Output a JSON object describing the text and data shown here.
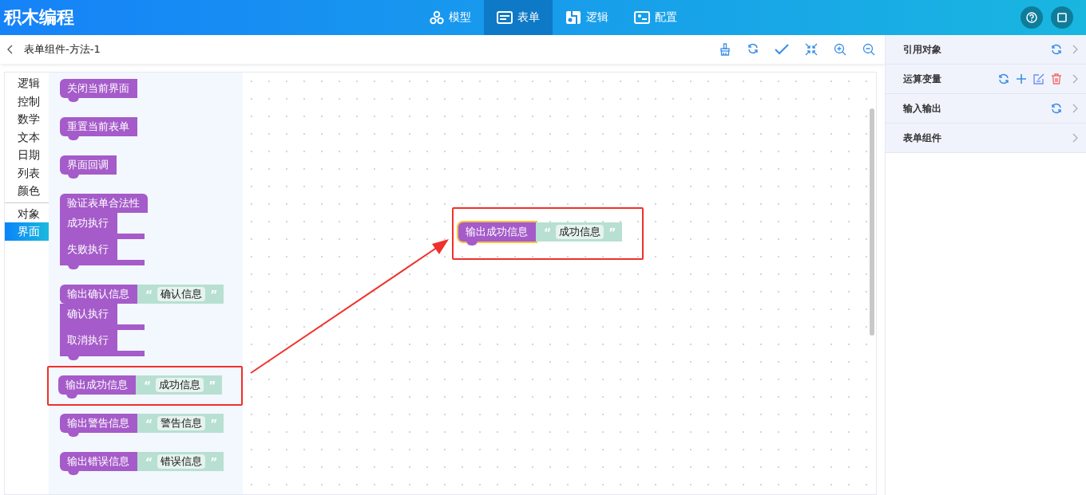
{
  "app": {
    "title": "积木编程"
  },
  "nav_tabs": [
    {
      "label": "模型",
      "kind": "model",
      "selected": false
    },
    {
      "label": "表单",
      "kind": "form",
      "selected": true
    },
    {
      "label": "逻辑",
      "kind": "logic",
      "selected": false
    },
    {
      "label": "配置",
      "kind": "config",
      "selected": false
    }
  ],
  "editor": {
    "title": "表单组件-方法-1"
  },
  "category_groups": [
    {
      "items": [
        {
          "label": "逻辑",
          "selected": false
        },
        {
          "label": "控制",
          "selected": false
        },
        {
          "label": "数学",
          "selected": false
        },
        {
          "label": "文本",
          "selected": false
        },
        {
          "label": "日期",
          "selected": false
        },
        {
          "label": "列表",
          "selected": false
        },
        {
          "label": "颜色",
          "selected": false
        }
      ]
    },
    {
      "items": [
        {
          "label": "对象",
          "selected": false
        },
        {
          "label": "界面",
          "selected": true
        }
      ]
    }
  ],
  "flyout_blocks": [
    {
      "kind": "simple",
      "label": "关闭当前界面"
    },
    {
      "kind": "simple",
      "label": "重置当前表单"
    },
    {
      "kind": "simple",
      "label": "界面回调"
    },
    {
      "kind": "branches",
      "label": "验证表单合法性",
      "branches": [
        "成功执行",
        "失败执行"
      ]
    },
    {
      "kind": "message",
      "label": "输出确认信息",
      "open_quote": "“",
      "value": "确认信息",
      "close_quote": "”",
      "branches": [
        "确认执行",
        "取消执行"
      ]
    },
    {
      "kind": "message",
      "label": "输出成功信息",
      "open_quote": "“",
      "value": "成功信息",
      "close_quote": "”",
      "highlighted": true
    },
    {
      "kind": "message",
      "label": "输出警告信息",
      "open_quote": "“",
      "value": "警告信息",
      "close_quote": "”"
    },
    {
      "kind": "message",
      "label": "输出错误信息",
      "open_quote": "“",
      "value": "错误信息",
      "close_quote": "”"
    }
  ],
  "canvas_block": {
    "label": "输出成功信息",
    "open_quote": "“",
    "value": "成功信息",
    "close_quote": "”",
    "selected": true
  },
  "side_panel": [
    {
      "label": "引用对象",
      "tools": [
        {
          "kind": "refresh"
        }
      ]
    },
    {
      "label": "运算变量",
      "tools": [
        {
          "kind": "refresh"
        },
        {
          "kind": "add"
        },
        {
          "kind": "edit"
        },
        {
          "kind": "delete"
        }
      ]
    },
    {
      "label": "输入输出",
      "tools": [
        {
          "kind": "refresh"
        }
      ]
    },
    {
      "label": "表单组件"
    }
  ]
}
